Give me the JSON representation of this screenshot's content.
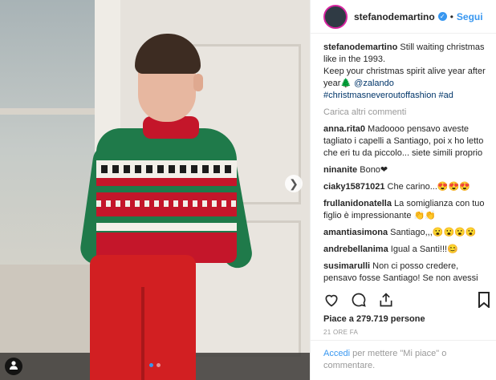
{
  "post": {
    "username": "stefanodemartino",
    "follow_label": "Segui",
    "separator": "•",
    "verified_glyph": "✓"
  },
  "caption": {
    "author": "stefanodemartino",
    "text": "Still waiting christmas like in the 1993.",
    "line2": "Keep your christmas spirit alive year after year🌲",
    "mention": "@zalando",
    "hashtags": "#christmasneveroutoffashion #ad"
  },
  "load_more": "Carica altri commenti",
  "comments": [
    {
      "user": "anna.rita0",
      "text": "Madoooo pensavo aveste tagliato i capelli a Santiago, poi x ho letto che eri tu da piccolo... siete simili proprio"
    },
    {
      "user": "ninanite",
      "text": "Bono❤"
    },
    {
      "user": "ciaky15871021",
      "text": "Che carino...😍😍😍"
    },
    {
      "user": "frullanidonatella",
      "text": "La somiglianza con tuo figlio è impressionante 👏👏"
    },
    {
      "user": "amantiasimona",
      "text": "Santiago,,,😮😮😮😮"
    },
    {
      "user": "andrebellanima",
      "text": "Igual a Santi!!!😊"
    },
    {
      "user": "susimarulli",
      "text": "Non ci posso credere, pensavo fosse Santiago! Se non avessi letto non ci avrei creduto! Identici!"
    }
  ],
  "likes": "Piace a 279.719 persone",
  "time": "21 ORE FA",
  "login": {
    "link": "Accedi",
    "rest": "per mettere \"Mi piace\" o commentare."
  },
  "icons": {
    "heart": "heart-icon",
    "comment": "comment-icon",
    "share": "share-icon",
    "save": "bookmark-icon",
    "next": "chevron-right-icon",
    "tag": "user-tag-icon"
  },
  "colors": {
    "accent": "#3897f0",
    "link": "#003569",
    "muted": "#999999"
  }
}
